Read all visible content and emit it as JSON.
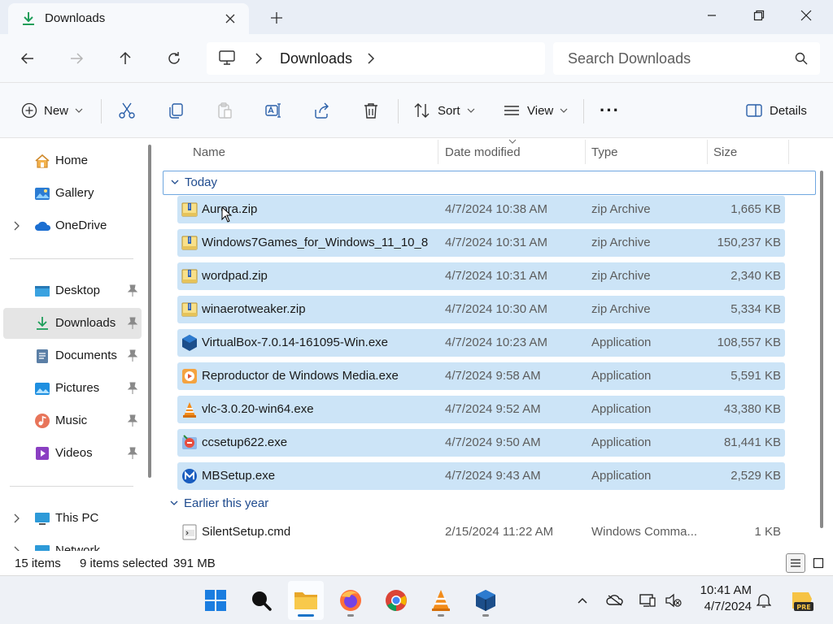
{
  "window": {
    "tab_title": "Downloads",
    "new_tab_label": "+"
  },
  "address": {
    "crumb": "Downloads",
    "search_placeholder": "Search Downloads"
  },
  "toolbar": {
    "new_label": "New",
    "sort_label": "Sort",
    "view_label": "View",
    "more_label": "···",
    "details_label": "Details"
  },
  "sidebar": {
    "home": "Home",
    "gallery": "Gallery",
    "onedrive": "OneDrive",
    "desktop": "Desktop",
    "downloads": "Downloads",
    "documents": "Documents",
    "pictures": "Pictures",
    "music": "Music",
    "videos": "Videos",
    "this_pc": "This PC",
    "network": "Network"
  },
  "columns": {
    "name": "Name",
    "date": "Date modified",
    "type": "Type",
    "size": "Size"
  },
  "groups": {
    "today": "Today",
    "earlier": "Earlier this year"
  },
  "files": [
    {
      "name": "Aurora.zip",
      "date": "4/7/2024 10:38 AM",
      "type": "zip Archive",
      "size": "1,665 KB",
      "icon": "zip-icon",
      "selected": true
    },
    {
      "name": "Windows7Games_for_Windows_11_10_8....",
      "date": "4/7/2024 10:31 AM",
      "type": "zip Archive",
      "size": "150,237 KB",
      "icon": "zip-icon",
      "selected": true
    },
    {
      "name": "wordpad.zip",
      "date": "4/7/2024 10:31 AM",
      "type": "zip Archive",
      "size": "2,340 KB",
      "icon": "zip-icon",
      "selected": true
    },
    {
      "name": "winaerotweaker.zip",
      "date": "4/7/2024 10:30 AM",
      "type": "zip Archive",
      "size": "5,334 KB",
      "icon": "zip-icon",
      "selected": true
    },
    {
      "name": "VirtualBox-7.0.14-161095-Win.exe",
      "date": "4/7/2024 10:23 AM",
      "type": "Application",
      "size": "108,557 KB",
      "icon": "virtualbox-icon",
      "selected": true
    },
    {
      "name": "Reproductor de Windows Media.exe",
      "date": "4/7/2024 9:58 AM",
      "type": "Application",
      "size": "5,591 KB",
      "icon": "media-player-icon",
      "selected": true
    },
    {
      "name": "vlc-3.0.20-win64.exe",
      "date": "4/7/2024 9:52 AM",
      "type": "Application",
      "size": "43,380 KB",
      "icon": "vlc-icon",
      "selected": true
    },
    {
      "name": "ccsetup622.exe",
      "date": "4/7/2024 9:50 AM",
      "type": "Application",
      "size": "81,441 KB",
      "icon": "ccleaner-icon",
      "selected": true
    },
    {
      "name": "MBSetup.exe",
      "date": "4/7/2024 9:43 AM",
      "type": "Application",
      "size": "2,529 KB",
      "icon": "malwarebytes-icon",
      "selected": true
    },
    {
      "name": "SilentSetup.cmd",
      "date": "2/15/2024 11:22 AM",
      "type": "Windows Comma...",
      "size": "1 KB",
      "icon": "cmd-file-icon",
      "selected": false
    }
  ],
  "status": {
    "items": "15 items",
    "selected": "9 items selected",
    "size": "391 MB"
  },
  "clock": {
    "time": "10:41 AM",
    "date": "4/7/2024"
  },
  "colors": {
    "selection": "#cce4f7",
    "accent": "#1a73c8",
    "folder": "#f4c542"
  }
}
